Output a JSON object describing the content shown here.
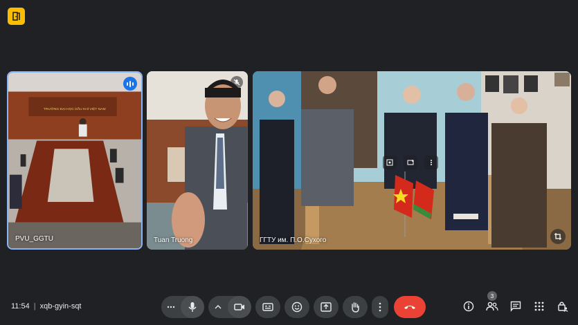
{
  "meeting": {
    "time": "11:54",
    "separator": "|",
    "code": "xqb-gyin-sqt"
  },
  "participants": [
    {
      "name": "PVU_GGTU",
      "speaking": true
    },
    {
      "name": "Tuan Truong",
      "muted": true
    },
    {
      "name": "ГГТУ им. П.О.Сухого",
      "pinned": true
    }
  ],
  "toolbar": {
    "more_options_label": "more",
    "buttons": [
      "microphone-icon",
      "camera-icon",
      "captions-icon",
      "emoji-icon",
      "present-icon",
      "raise-hand-icon",
      "more-vert-icon",
      "end-call-icon"
    ]
  },
  "side": {
    "people_count": "3"
  },
  "colors": {
    "accent": "#8ab4f8",
    "end_call": "#ea4335",
    "logo": "#fbbc04",
    "speaking": "#1a73e8"
  }
}
